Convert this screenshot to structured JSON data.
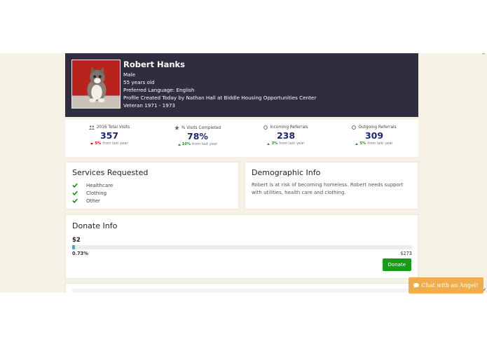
{
  "profile": {
    "name": "Robert Hanks",
    "gender": "Male",
    "age": "55 years old",
    "language": "Preferred Language: English",
    "created": "Profile Created Today by Nathan Hall at Biddle Housing Opportunities Center",
    "veteran": "Veteran 1971 - 1973"
  },
  "stats": [
    {
      "icon": "users-icon",
      "label": "2016 Total Visits",
      "value": "357",
      "direction": "down",
      "pct": "5%",
      "suffix": "from last year"
    },
    {
      "icon": "star-icon",
      "label": "% Visits Completed",
      "value": "78%",
      "direction": "up",
      "pct": "10%",
      "suffix": "from last year"
    },
    {
      "icon": "circle-icon",
      "label": "Incoming Referrals",
      "value": "238",
      "direction": "up",
      "pct": "3%",
      "suffix": "from last year"
    },
    {
      "icon": "circle-icon",
      "label": "Outgoing Referrals",
      "value": "309",
      "direction": "up",
      "pct": "5%",
      "suffix": "from last year"
    }
  ],
  "services": {
    "title": "Services Requested",
    "items": [
      "Healthcare",
      "Clothing",
      "Other"
    ]
  },
  "demographic": {
    "title": "Demographic Info",
    "text": "Robert is at risk of becoming homeless. Robert needs support with utilities, health care and clothing."
  },
  "donate": {
    "title": "Donate Info",
    "amount": "$2",
    "percent_label": "0.73%",
    "progress_percent": 0.73,
    "goal": "$273",
    "button_label": "Donate"
  },
  "chat": {
    "label": "Chat with an Angel!"
  },
  "colors": {
    "profile_bg": "#2f2e3f",
    "stat_value": "#1a2a6c",
    "positive": "#2e8b2e",
    "negative": "#d0021b",
    "donate_button": "#1a9a1a",
    "chat_button": "#f0ad4e",
    "page_bg": "#f6f1e5"
  }
}
